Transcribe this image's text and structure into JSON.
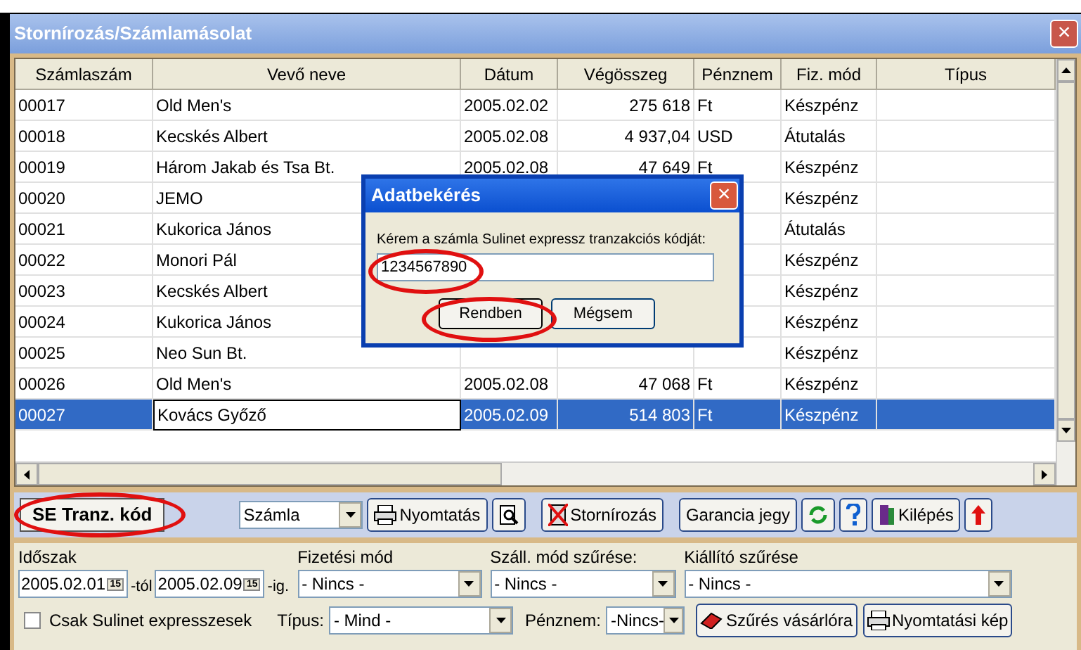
{
  "window": {
    "title": "Stornírozás/Számlamásolat",
    "close": "×"
  },
  "table": {
    "columns": [
      "Számlaszám",
      "Vevő neve",
      "Dátum",
      "Végösszeg",
      "Pénznem",
      "Fiz. mód",
      "Típus"
    ],
    "rows": [
      {
        "number": "00017",
        "customer": "Old Men's",
        "date": "2005.02.02",
        "total": "275 618",
        "currency": "Ft",
        "payment": "Készpénz",
        "selected": false
      },
      {
        "number": "00018",
        "customer": "Kecskés Albert",
        "date": "2005.02.08",
        "total": "4 937,04",
        "currency": "USD",
        "payment": "Átutalás",
        "selected": false
      },
      {
        "number": "00019",
        "customer": "Három Jakab és Tsa Bt.",
        "date": "2005.02.08",
        "total": "47 649",
        "currency": "Ft",
        "payment": "Készpénz",
        "selected": false
      },
      {
        "number": "00020",
        "customer": "JEMO",
        "payment": "Készpénz",
        "selected": false
      },
      {
        "number": "00021",
        "customer": "Kukorica János",
        "payment": "Átutalás",
        "selected": false
      },
      {
        "number": "00022",
        "customer": "Monori Pál",
        "payment": "Készpénz",
        "selected": false
      },
      {
        "number": "00023",
        "customer": "Kecskés Albert",
        "payment": "Készpénz",
        "selected": false
      },
      {
        "number": "00024",
        "customer": "Kukorica János",
        "payment": "Készpénz",
        "selected": false
      },
      {
        "number": "00025",
        "customer": "Neo Sun Bt.",
        "payment": "Készpénz",
        "selected": false
      },
      {
        "number": "00026",
        "customer": "Old Men's",
        "date": "2005.02.08",
        "total": "47 068",
        "currency": "Ft",
        "payment": "Készpénz",
        "selected": false
      },
      {
        "number": "00027",
        "customer": "Kovács Győző",
        "date": "2005.02.09",
        "total": "514 803",
        "currency": "Ft",
        "payment": "Készpénz",
        "selected": true
      }
    ]
  },
  "dialog": {
    "title": "Adatbekérés",
    "close": "×",
    "prompt": "Kérem a számla Sulinet expressz tranzakciós kódját:",
    "value": "1234567890",
    "buttons": [
      "Rendben",
      "Mégsem"
    ]
  },
  "toolbar": {
    "code_button": "SE Tranz. kód",
    "document_select": "Számla",
    "print": "Nyomtatás",
    "storno": "Stornírozás",
    "warranty": "Garancia jegy",
    "exit": "Kilépés"
  },
  "filters": {
    "period_label": "Időszak",
    "from": "2005.02.01",
    "from_suffix": "-tól",
    "to": "2005.02.09",
    "to_suffix": "-ig.",
    "from_calendar": "15",
    "to_calendar": "15",
    "payment_label": "Fizetési mód",
    "payment": "- Nincs -",
    "shipping_label": "Száll. mód szűrése:",
    "shipping": "- Nincs -",
    "issuer_label": "Kiállító szűrése",
    "issuer": "- Nincs -",
    "only_sulinet": {
      "label": "Csak Sulinet expresszesek",
      "checked": false
    },
    "type_label": "Típus:",
    "type": "- Mind -",
    "currency_label": "Pénznem:",
    "currency": "-Nincs-",
    "filter_button": "Szűrés vásárlóra",
    "preview_button": "Nyomtatási kép"
  }
}
